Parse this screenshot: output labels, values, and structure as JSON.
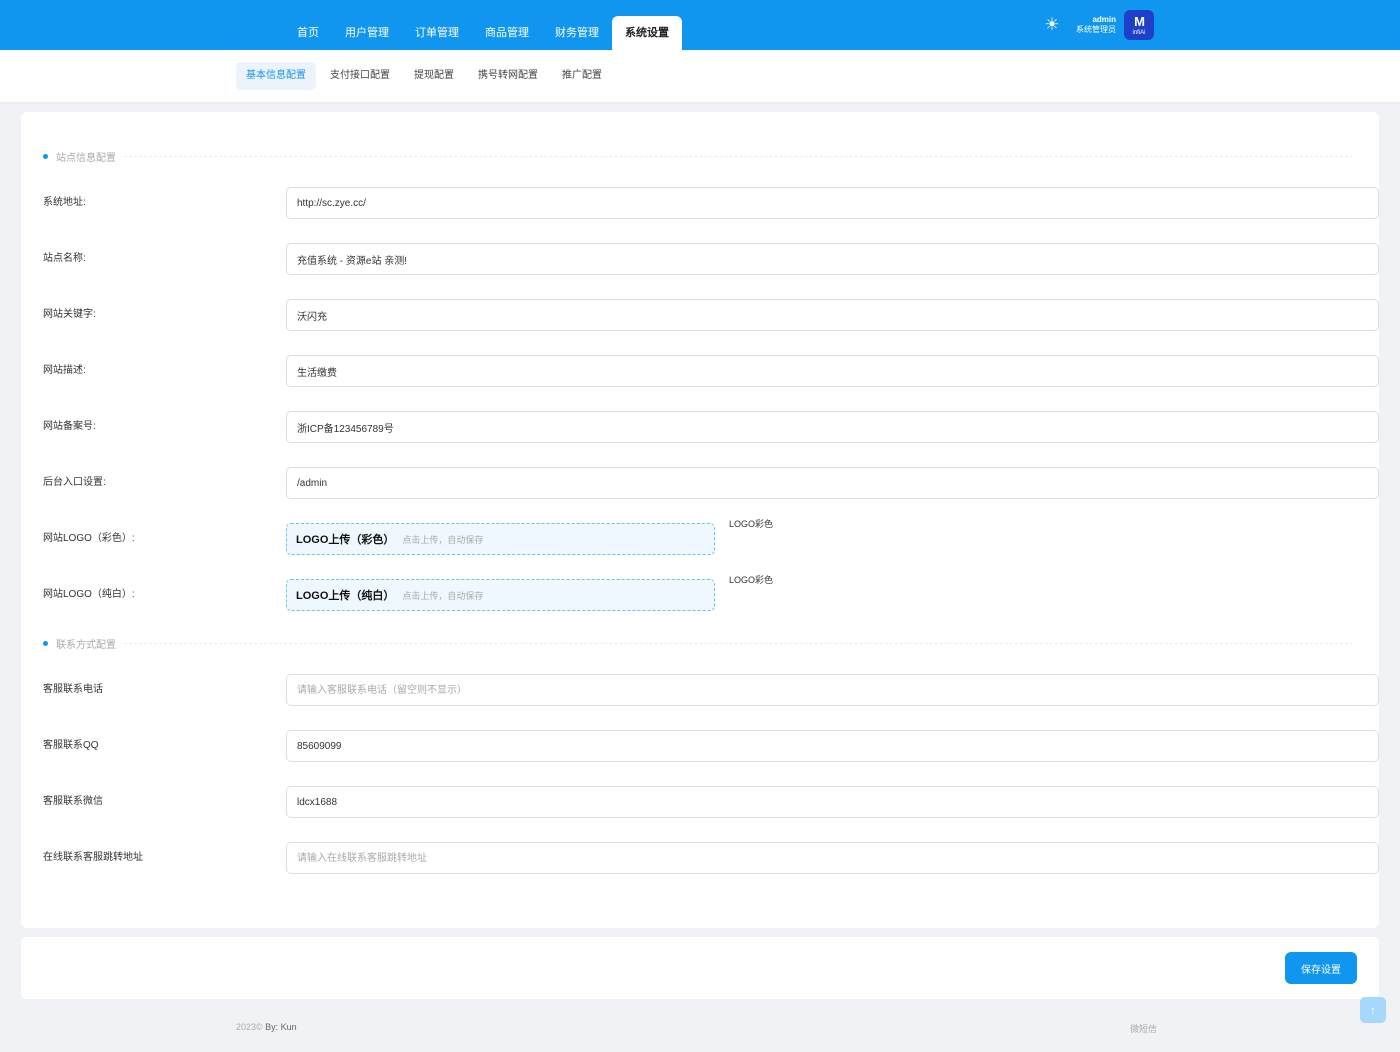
{
  "header": {
    "nav": [
      {
        "label": "首页",
        "active": false
      },
      {
        "label": "用户管理",
        "active": false
      },
      {
        "label": "订单管理",
        "active": false
      },
      {
        "label": "商品管理",
        "active": false
      },
      {
        "label": "财务管理",
        "active": false
      },
      {
        "label": "系统设置",
        "active": true
      }
    ],
    "theme_icon": "sun-icon",
    "user": {
      "name": "admin",
      "role": "系统管理员",
      "avatar_mark": "M",
      "avatar_sub": "infiAi"
    }
  },
  "subtabs": [
    {
      "label": "基本信息配置",
      "active": true
    },
    {
      "label": "支付接口配置",
      "active": false
    },
    {
      "label": "提现配置",
      "active": false
    },
    {
      "label": "携号转网配置",
      "active": false
    },
    {
      "label": "推广配置",
      "active": false
    }
  ],
  "site_section": {
    "title": "站点信息配置",
    "fields": {
      "system_url": {
        "label": "系统地址:",
        "value": "http://sc.zye.cc/"
      },
      "site_name": {
        "label": "站点名称:",
        "value": "充值系统 - 资源e站 亲测!"
      },
      "keywords": {
        "label": "网站关键字:",
        "value": "沃闪充"
      },
      "description": {
        "label": "网站描述:",
        "value": "生活缴费"
      },
      "icp": {
        "label": "网站备案号:",
        "value": "浙ICP备123456789号"
      },
      "admin_entry": {
        "label": "后台入口设置:",
        "value": "/admin"
      }
    },
    "logo_color": {
      "label": "网站LOGO（彩色）:",
      "upload_title": "LOGO上传（彩色）",
      "upload_hint": "点击上传，自动保存",
      "preview": "LOGO彩色"
    },
    "logo_white": {
      "label": "网站LOGO（纯白）:",
      "upload_title": "LOGO上传（纯白）",
      "upload_hint": "点击上传，自动保存",
      "preview": "LOGO彩色"
    }
  },
  "contact_section": {
    "title": "联系方式配置",
    "fields": {
      "phone": {
        "label": "客服联系电话",
        "value": "",
        "placeholder": "请输入客服联系电话（留空则不显示）"
      },
      "qq": {
        "label": "客服联系QQ",
        "value": "85609099",
        "placeholder": ""
      },
      "wechat": {
        "label": "客服联系微信",
        "value": "ldcx1688",
        "placeholder": ""
      },
      "online_url": {
        "label": "在线联系客服跳转地址",
        "value": "",
        "placeholder": "请输入在线联系客服跳转地址"
      }
    }
  },
  "save_label": "保存设置",
  "footer": {
    "year": "2023©",
    "by": "By: Kun",
    "right": "微短信"
  },
  "colors": {
    "primary": "#1196ef",
    "page_bg": "#f0f2f5"
  }
}
